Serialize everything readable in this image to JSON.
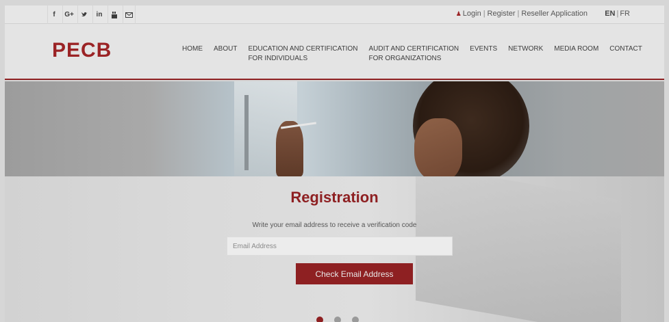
{
  "social": [
    {
      "icon": "facebook-icon",
      "glyph": "f"
    },
    {
      "icon": "google-plus-icon",
      "glyph": "G+"
    },
    {
      "icon": "twitter-icon",
      "glyph": "🐦"
    },
    {
      "icon": "linkedin-icon",
      "glyph": "in"
    },
    {
      "icon": "youtube-icon",
      "glyph": "▣"
    },
    {
      "icon": "mail-icon",
      "glyph": "✉"
    }
  ],
  "account": {
    "user_icon": "user-icon",
    "login": "Login",
    "register": "Register",
    "reseller": "Reseller Application",
    "sep": "|"
  },
  "lang": {
    "en": "EN",
    "fr": "FR",
    "sep": "|"
  },
  "logo": "PECB",
  "nav": [
    "HOME",
    "ABOUT",
    "EDUCATION AND CERTIFICATION\nFOR INDIVIDUALS",
    "AUDIT AND CERTIFICATION\nFOR ORGANIZATIONS",
    "EVENTS",
    "NETWORK",
    "MEDIA ROOM",
    "CONTACT"
  ],
  "registration": {
    "title": "Registration",
    "subtitle": "Write your email address to receive a verification code",
    "email_placeholder": "Email Address",
    "button": "Check Email Address"
  },
  "slider": {
    "count": 3,
    "active": 0
  },
  "colors": {
    "brand": "#9b2325"
  }
}
